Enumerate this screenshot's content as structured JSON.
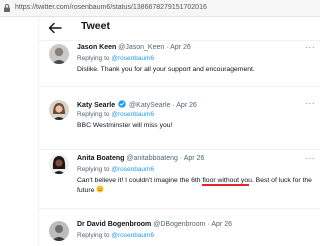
{
  "browser": {
    "url": "https://twitter.com/rosenbaum6/status/1386678279151702016"
  },
  "header": {
    "title": "Tweet"
  },
  "tweets": [
    {
      "name": "Jason Keen",
      "handle": "@Jason_Keen",
      "dot": "·",
      "date": "Apr 26",
      "replying_prefix": "Replying to",
      "replying_to": "@rosenbaum6",
      "text": "Dislike. Thank you for all your support and encouragement.",
      "verified": false
    },
    {
      "name": "Katy Searle",
      "handle": "@KatySearle",
      "dot": "·",
      "date": "Apr 26",
      "replying_prefix": "Replying to",
      "replying_to": "@rosenbaum6",
      "text": "BBC Westminster will miss you!",
      "verified": true
    },
    {
      "name": "Anita Boateng",
      "handle": "@anitabboateng",
      "dot": "·",
      "date": "Apr 26",
      "replying_prefix": "Replying to",
      "replying_to": "@rosenbaum6",
      "text_before": "Can't believe it! I couldn't imagine the ",
      "text_highlight": "6th floor",
      "text_after": " without you. Best of luck for the future ",
      "emoji": "smiling-face-emoji",
      "verified": false
    },
    {
      "name": "Dr David Bogenbroom",
      "handle": "@DBogenbroom",
      "dot": "·",
      "date": "Apr 26",
      "replying_prefix": "Replying to",
      "replying_to": "@rosenbaum6",
      "verified": false
    }
  ],
  "colors": {
    "accent": "#1d9bf0",
    "underline": "#e0262a",
    "muted": "#536471"
  },
  "icons": {
    "back": "back-arrow-icon",
    "lock": "lock-icon",
    "verified": "verified-badge-icon",
    "more": "more-options-icon"
  }
}
